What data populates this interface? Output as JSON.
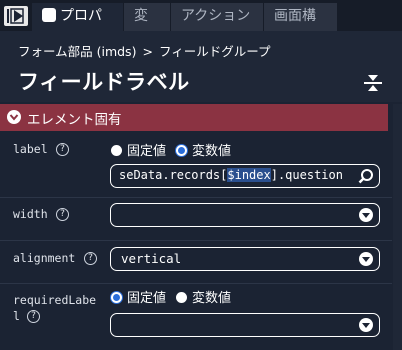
{
  "tabs": [
    {
      "label": "プロパティ",
      "active": true
    },
    {
      "label": "変数",
      "active": false
    },
    {
      "label": "アクション",
      "active": false
    },
    {
      "label": "画面構成",
      "active": false
    }
  ],
  "breadcrumb": {
    "part": "フォーム部品 (imds)",
    "separator": ">",
    "current": "フィールドグループ"
  },
  "page_title": "フィールドラベル",
  "section": {
    "title": "エレメント固有",
    "expanded": true
  },
  "fields": {
    "label": {
      "name": "label",
      "options": [
        "固定値",
        "変数値"
      ],
      "selected": "変数値",
      "value_prefix": "seData.records[",
      "value_highlight": "$index",
      "value_suffix": "].question"
    },
    "width": {
      "name": "width",
      "value": ""
    },
    "alignment": {
      "name": "alignment",
      "value": "vertical"
    },
    "required": {
      "name_line1": "requiredLabe",
      "name_line2": "l",
      "options": [
        "固定値",
        "変数値"
      ],
      "selected": "固定値",
      "value": ""
    }
  },
  "icons": {
    "collapse_panel": "panel-collapse-icon",
    "collapse_all": "collapse-all-icon",
    "help": "help-icon",
    "search": "search-icon",
    "dropdown": "chevron-down-icon"
  },
  "colors": {
    "background": "#1b2333",
    "header": "#1f2737",
    "section": "#8b3342",
    "accent": "#2a6dd9"
  }
}
